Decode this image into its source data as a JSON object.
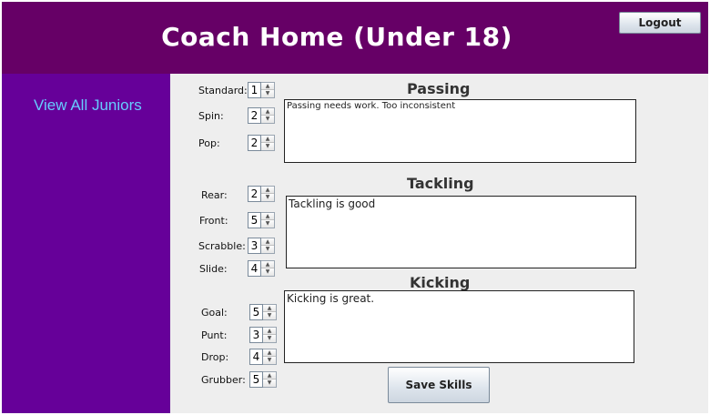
{
  "header": {
    "title": "Coach Home (Under 18)",
    "logout_label": "Logout"
  },
  "sidebar": {
    "link_label": "View All Juniors"
  },
  "passing": {
    "title": "Passing",
    "comment": "Passing needs work. Too inconsistent",
    "skills": [
      {
        "label": "Standard:",
        "value": "1"
      },
      {
        "label": "Spin:",
        "value": "2"
      },
      {
        "label": "Pop:",
        "value": "2"
      }
    ]
  },
  "tackling": {
    "title": "Tackling",
    "comment": "Tackling is good",
    "skills": [
      {
        "label": "Rear:",
        "value": "2"
      },
      {
        "label": "Front:",
        "value": "5"
      },
      {
        "label": "Scrabble:",
        "value": "3"
      },
      {
        "label": "Slide:",
        "value": "4"
      }
    ]
  },
  "kicking": {
    "title": "Kicking",
    "comment": "Kicking is great.",
    "skills": [
      {
        "label": "Goal:",
        "value": "5"
      },
      {
        "label": "Punt:",
        "value": "3"
      },
      {
        "label": "Drop:",
        "value": "4"
      },
      {
        "label": "Grubber:",
        "value": "5"
      }
    ]
  },
  "actions": {
    "save_label": "Save Skills"
  },
  "colors": {
    "header_bg": "#660066",
    "sidebar_bg": "#660099",
    "link": "#66ccff",
    "panel_bg": "#eeeeee"
  },
  "icons": {
    "spinner_up": "up-arrow-icon",
    "spinner_down": "down-arrow-icon"
  }
}
